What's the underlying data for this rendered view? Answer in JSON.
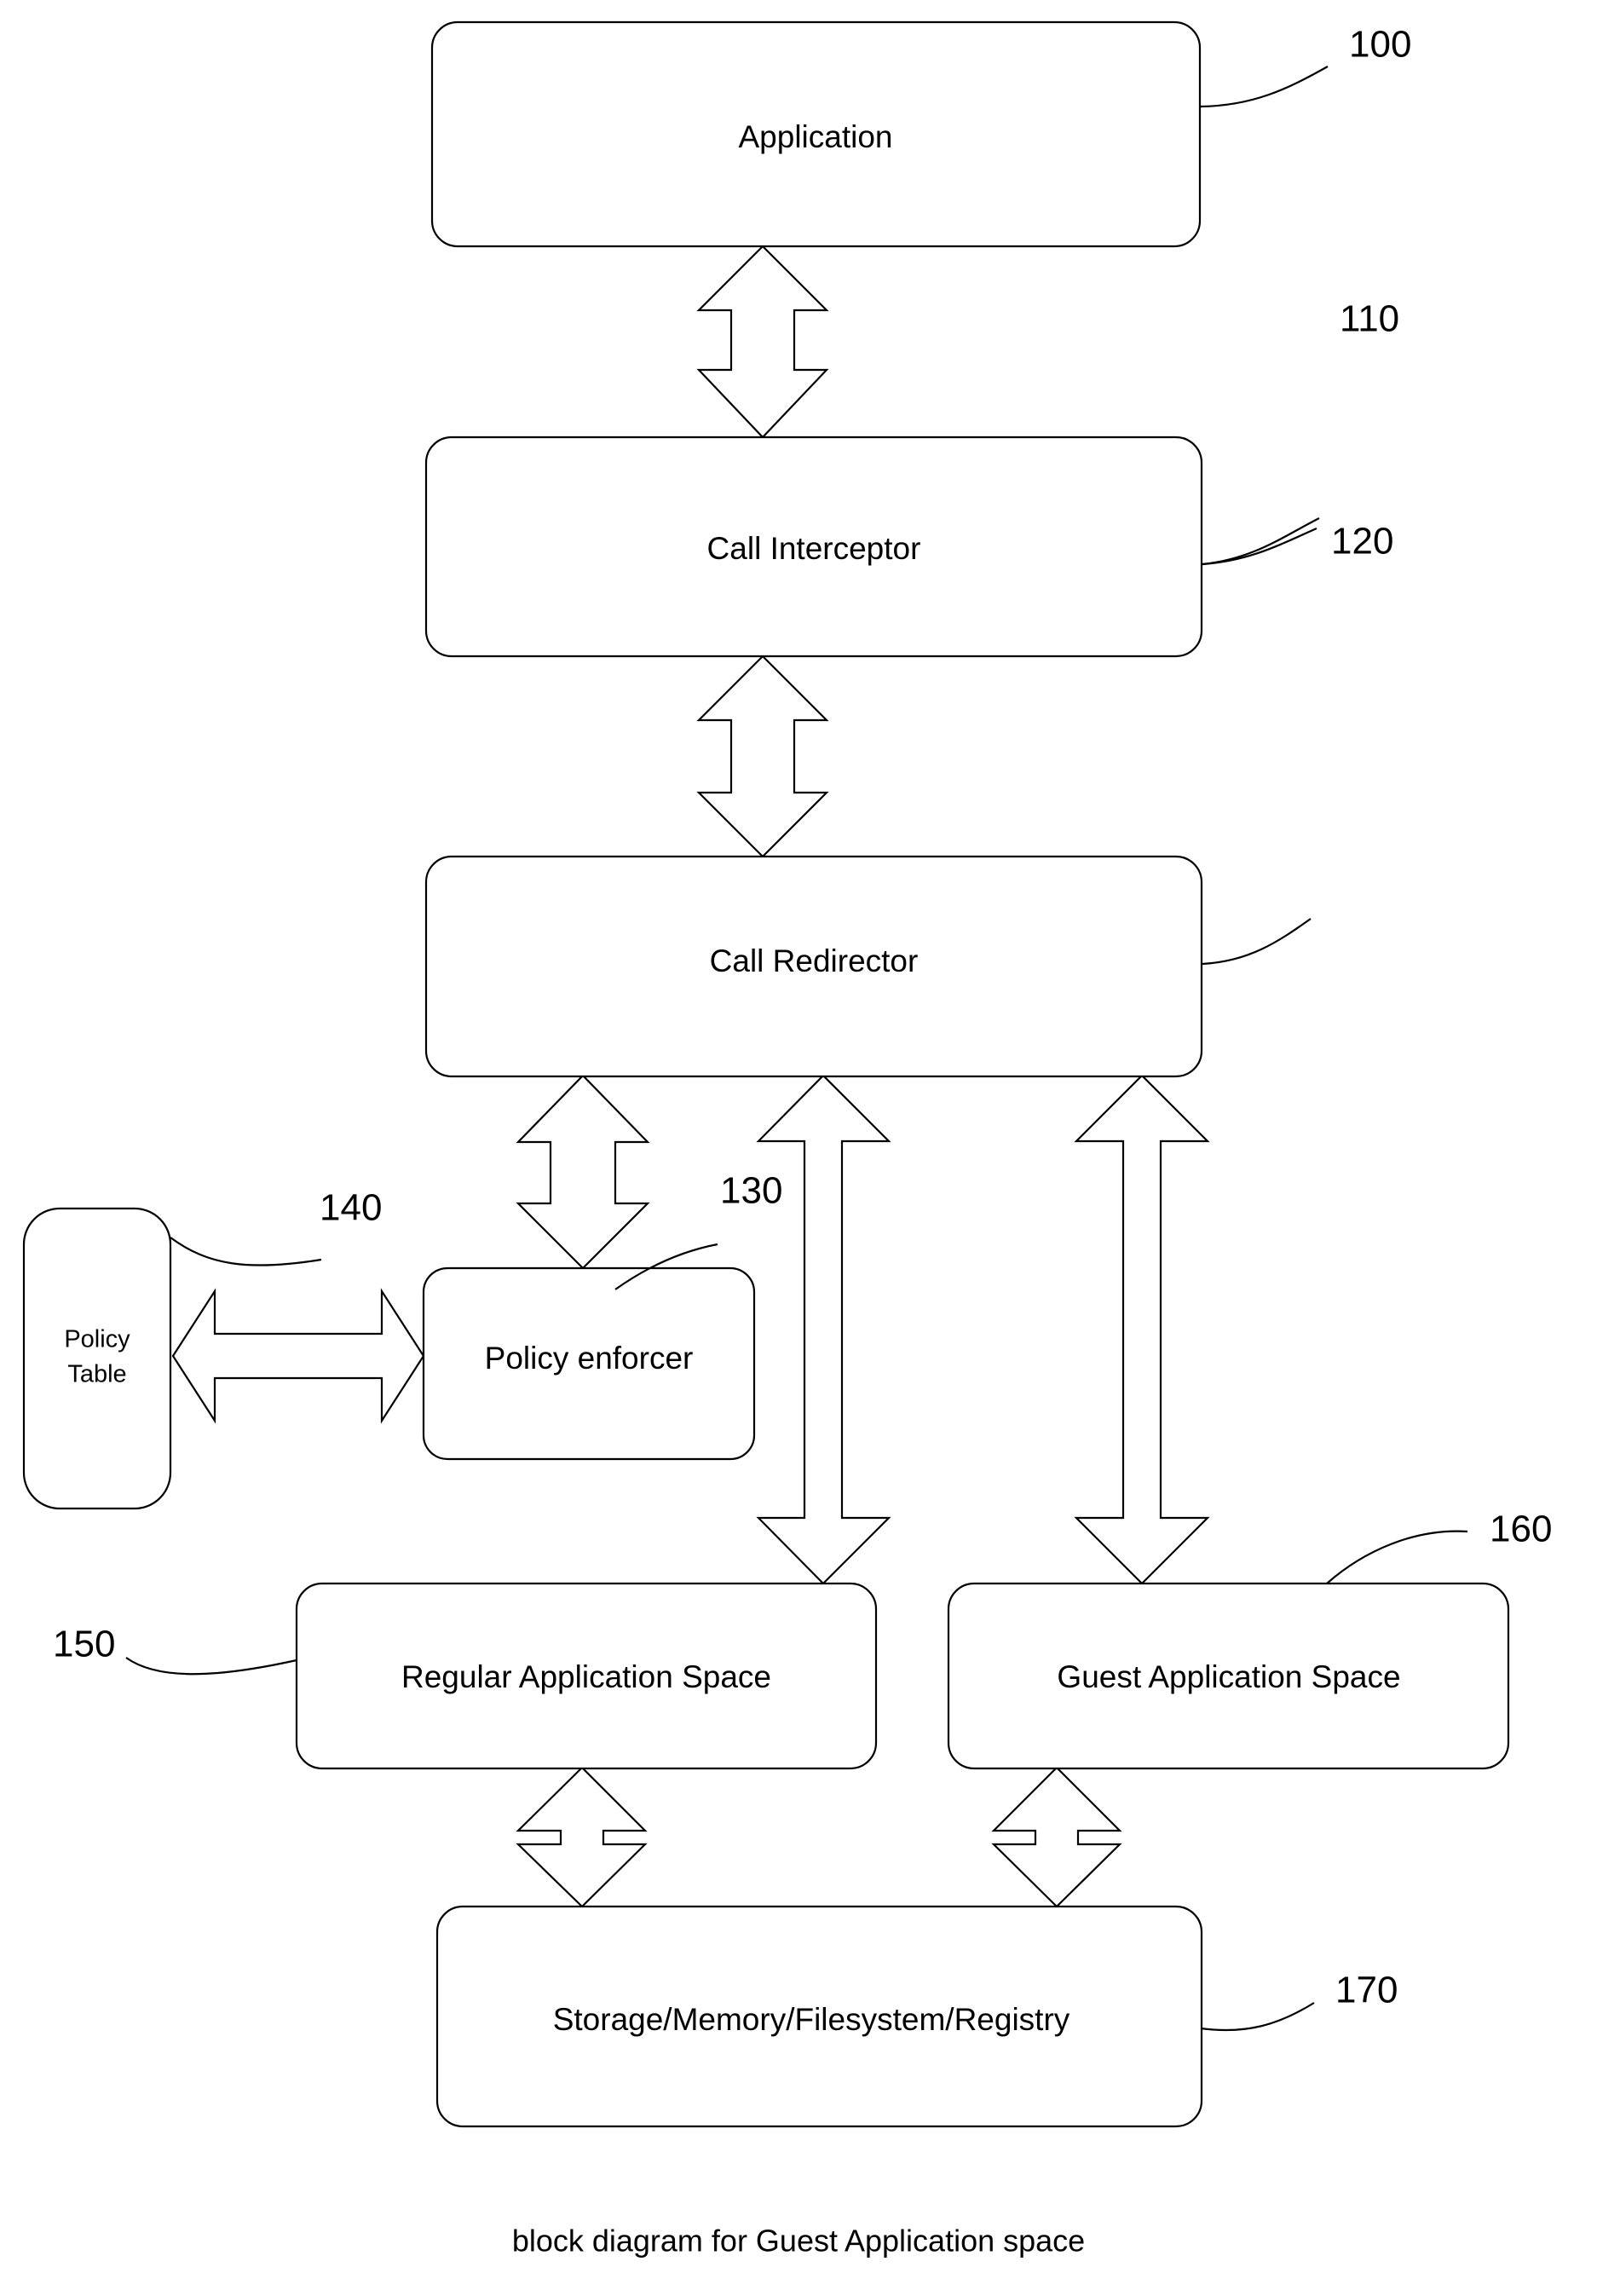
{
  "figure": {
    "caption": "block diagram for Guest Application space",
    "background_color": "#ffffff",
    "line_color": "#000000"
  },
  "blocks": [
    {
      "id": "application",
      "label": "Application",
      "ref": "100"
    },
    {
      "id": "call-interceptor",
      "label": "Call Interceptor",
      "ref": "110"
    },
    {
      "id": "call-redirector",
      "label": "Call Redirector",
      "ref": "120"
    },
    {
      "id": "policy-enforcer",
      "label": "Policy enforcer",
      "ref": "130"
    },
    {
      "id": "policy-table",
      "label_line1": "Policy",
      "label_line2": "Table",
      "ref": "140"
    },
    {
      "id": "regular-application-space",
      "label": "Regular Application Space",
      "ref": "150"
    },
    {
      "id": "guest-application-space",
      "label": "Guest Application Space",
      "ref": "160"
    },
    {
      "id": "storage-memory-filesystem-registry",
      "label": "Storage/Memory/Filesystem/Registry",
      "ref": "170"
    }
  ],
  "connections": [
    {
      "id": "application-to-call-interceptor",
      "from": "application",
      "to": "call-interceptor",
      "direction": "bidirectional",
      "orientation": "vertical"
    },
    {
      "id": "call-interceptor-to-call-redirector",
      "from": "call-interceptor",
      "to": "call-redirector",
      "direction": "bidirectional",
      "orientation": "vertical"
    },
    {
      "id": "call-redirector-to-policy-enforcer",
      "from": "call-redirector",
      "to": "policy-enforcer",
      "direction": "bidirectional",
      "orientation": "vertical"
    },
    {
      "id": "call-redirector-to-regular-application-space",
      "from": "call-redirector",
      "to": "regular-application-space",
      "direction": "bidirectional",
      "orientation": "vertical"
    },
    {
      "id": "call-redirector-to-guest-application-space",
      "from": "call-redirector",
      "to": "guest-application-space",
      "direction": "bidirectional",
      "orientation": "vertical"
    },
    {
      "id": "policy-table-to-policy-enforcer",
      "from": "policy-table",
      "to": "policy-enforcer",
      "direction": "bidirectional",
      "orientation": "horizontal"
    },
    {
      "id": "regular-application-space-to-storage",
      "from": "regular-application-space",
      "to": "storage-memory-filesystem-registry",
      "direction": "bidirectional",
      "orientation": "vertical"
    },
    {
      "id": "guest-application-space-to-storage",
      "from": "guest-application-space",
      "to": "storage-memory-filesystem-registry",
      "direction": "bidirectional",
      "orientation": "vertical"
    }
  ]
}
